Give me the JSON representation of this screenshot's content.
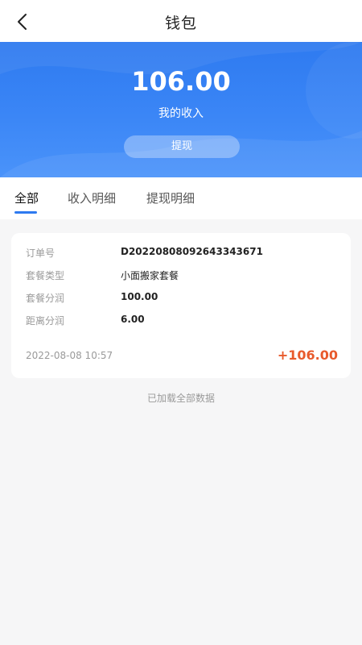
{
  "navbar": {
    "title": "钱包",
    "back_icon": "chevron-left-icon"
  },
  "banner": {
    "amount": "106.00",
    "label": "我的收入",
    "withdraw_label": "提现"
  },
  "tabs": [
    {
      "label": "全部",
      "active": true
    },
    {
      "label": "收入明细",
      "active": false
    },
    {
      "label": "提现明细",
      "active": false
    }
  ],
  "order_card": {
    "fields": [
      {
        "label": "订单号",
        "value": "D20220808092643343671"
      },
      {
        "label": "套餐类型",
        "value": "小面搬家套餐"
      },
      {
        "label": "套餐分润",
        "value": "100.00"
      },
      {
        "label": "距离分润",
        "value": "6.00"
      }
    ],
    "time": "2022-08-08 10:57",
    "amount": "+106.00"
  },
  "footer": {
    "note": "已加载全部数据"
  },
  "colors": {
    "accent": "#2e7af0",
    "income": "#e85a2c"
  }
}
